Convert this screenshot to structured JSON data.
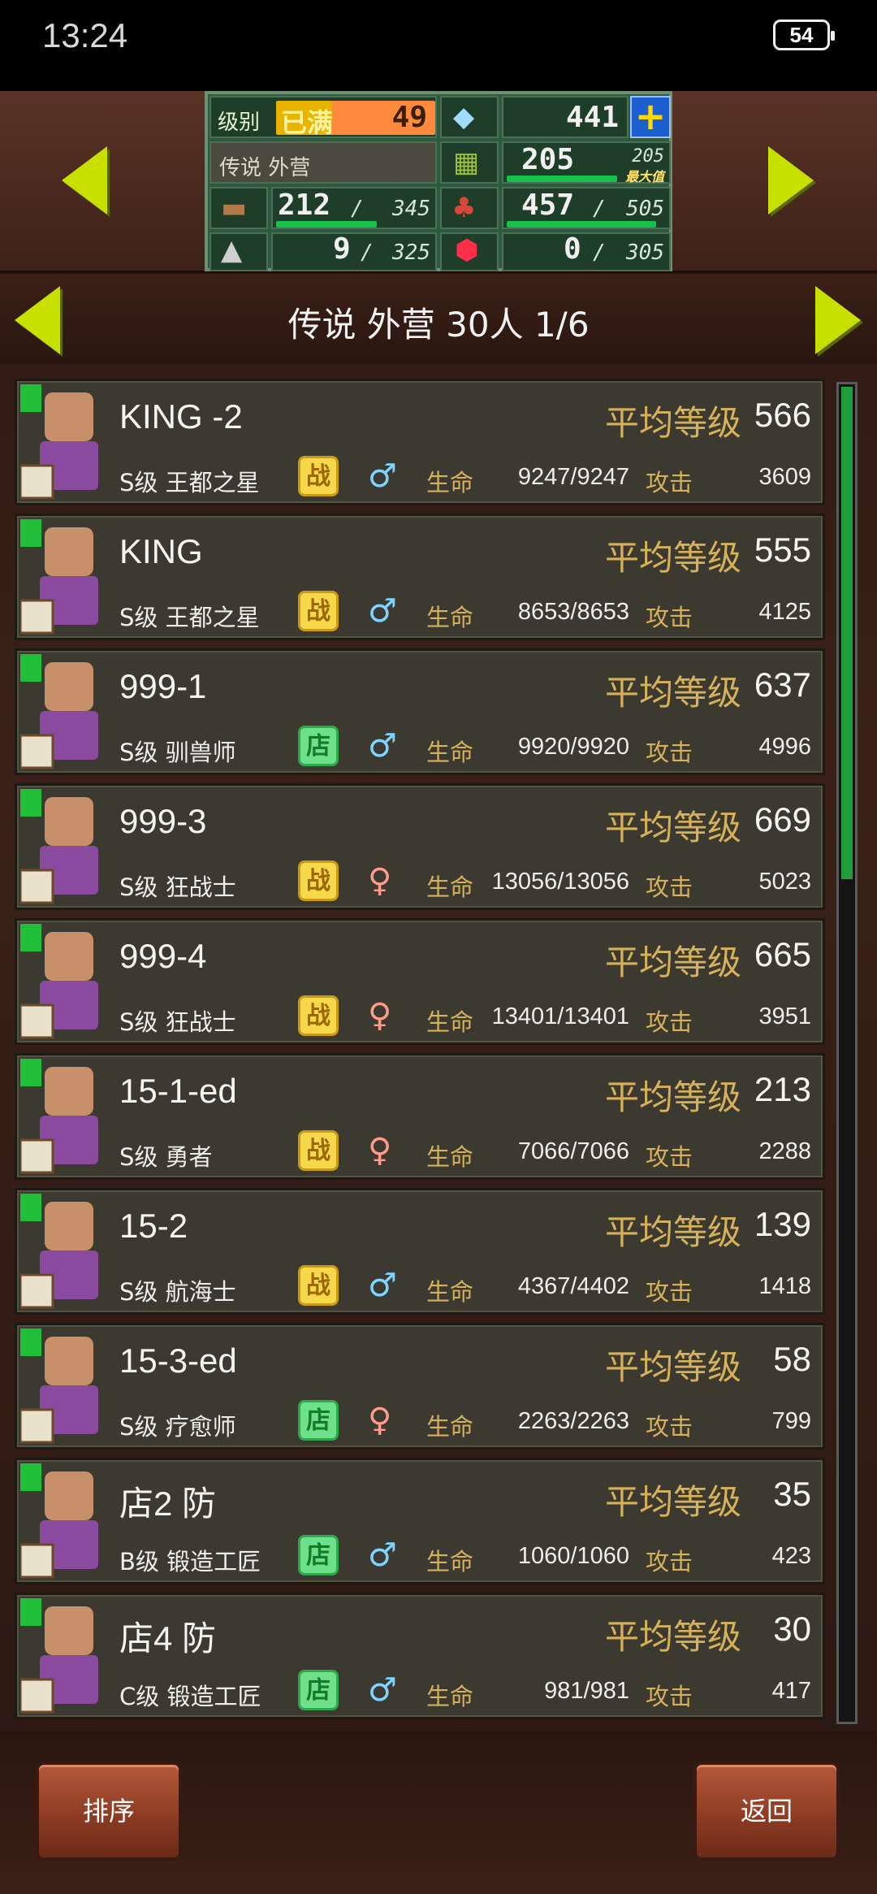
{
  "status_bar": {
    "time": "13:24",
    "battery": "54"
  },
  "resources": {
    "rank_label": "级别",
    "rank_badge": "已满",
    "rank_value": "49",
    "gems": "441",
    "add": "+",
    "title": "传说 外营",
    "grass": "205",
    "grass_max": "205",
    "grass_max_tag": "最大值",
    "wood": "212",
    "wood_max": "345",
    "food": "457",
    "food_max": "505",
    "ore": "9",
    "ore_max": "325",
    "ruby": "0",
    "ruby_max": "305"
  },
  "header": {
    "title": "传说 外营  30人 1/6"
  },
  "labels": {
    "avg": "平均等级",
    "hp": "生命",
    "atk": "攻击"
  },
  "rows": [
    {
      "name": "KING -2",
      "level": "566",
      "class": "S级 王都之星",
      "badge": "战",
      "badge_type": "zhan",
      "gender": "male",
      "hp": "9247/9247",
      "atk": "3609"
    },
    {
      "name": "KING",
      "level": "555",
      "class": "S级 王都之星",
      "badge": "战",
      "badge_type": "zhan",
      "gender": "male",
      "hp": "8653/8653",
      "atk": "4125"
    },
    {
      "name": "999-1",
      "level": "637",
      "class": "S级 驯兽师",
      "badge": "店",
      "badge_type": "dian",
      "gender": "male",
      "hp": "9920/9920",
      "atk": "4996"
    },
    {
      "name": "999-3",
      "level": "669",
      "class": "S级 狂战士",
      "badge": "战",
      "badge_type": "zhan",
      "gender": "female",
      "hp": "13056/13056",
      "atk": "5023"
    },
    {
      "name": "999-4",
      "level": "665",
      "class": "S级 狂战士",
      "badge": "战",
      "badge_type": "zhan",
      "gender": "female",
      "hp": "13401/13401",
      "atk": "3951"
    },
    {
      "name": "15-1-ed",
      "level": "213",
      "class": "S级 勇者",
      "badge": "战",
      "badge_type": "zhan",
      "gender": "female",
      "hp": "7066/7066",
      "atk": "2288"
    },
    {
      "name": "15-2",
      "level": "139",
      "class": "S级 航海士",
      "badge": "战",
      "badge_type": "zhan",
      "gender": "male",
      "hp": "4367/4402",
      "atk": "1418"
    },
    {
      "name": "15-3-ed",
      "level": "58",
      "class": "S级 疗愈师",
      "badge": "店",
      "badge_type": "dian",
      "gender": "female",
      "hp": "2263/2263",
      "atk": "799"
    },
    {
      "name": "店2 防",
      "level": "35",
      "class": "B级 锻造工匠",
      "badge": "店",
      "badge_type": "dian",
      "gender": "male",
      "hp": "1060/1060",
      "atk": "423"
    },
    {
      "name": "店4 防",
      "level": "30",
      "class": "C级 锻造工匠",
      "badge": "店",
      "badge_type": "dian",
      "gender": "male",
      "hp": "981/981",
      "atk": "417"
    }
  ],
  "footer": {
    "sort": "排序",
    "back": "返回"
  },
  "colors": {
    "accent_green": "#c8e000",
    "gold_text": "#d6b15c",
    "panel_green": "#2e5a3e",
    "button_brown": "#8a3a22"
  }
}
